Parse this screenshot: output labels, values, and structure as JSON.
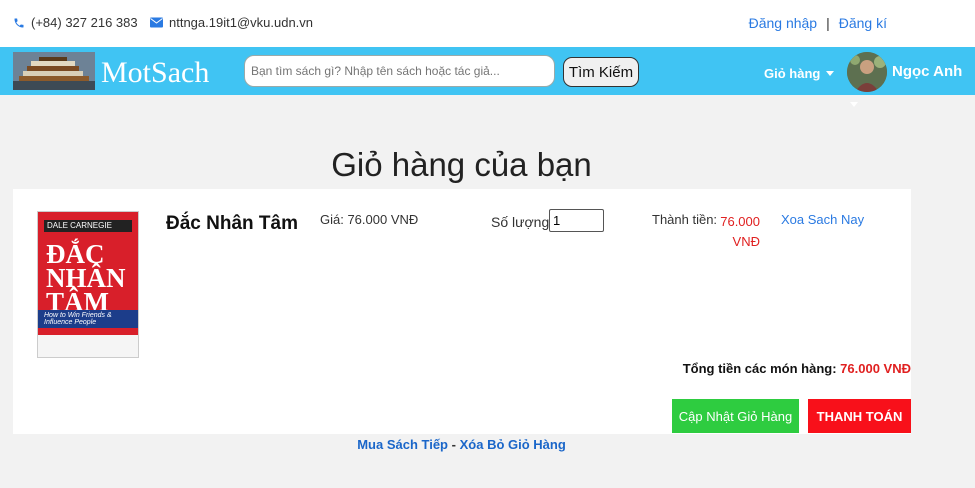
{
  "topbar": {
    "phone": "(+84) 327 216 383",
    "email": "nttnga.19it1@vku.udn.vn",
    "login": "Đăng nhập",
    "separator": "|",
    "register": "Đăng kí"
  },
  "navbar": {
    "logo_text": "MotSach",
    "search_placeholder": "Bạn tìm sách gì? Nhập tên sách hoặc tác giả...",
    "search_button": "Tìm Kiếm",
    "cart_menu": "Giỏ hàng",
    "user_name": "Ngọc Anh"
  },
  "page": {
    "title": "Giỏ hàng của bạn"
  },
  "cart": {
    "items": [
      {
        "title": "Đắc Nhân Tâm",
        "price_label": "Giá: 76.000 VNĐ",
        "qty_label": "Số lượng:",
        "qty_value": "1",
        "subtotal_label": "Thành tiền:",
        "subtotal_value": "76.000 VNĐ",
        "remove": "Xoa Sach Nay",
        "cover": {
          "author": "DALE CARNEGIE",
          "title": "ĐẮC NHÂN TÂM",
          "subtitle": "How to Win Friends & Influence People"
        }
      }
    ],
    "total_label": "Tổng tiền các món hàng:",
    "total_value": "76.000 VNĐ",
    "update_button": "Cập Nhật Giỏ Hàng",
    "pay_button": "THANH TOÁN"
  },
  "footer_links": {
    "continue": "Mua Sách Tiếp",
    "dash": "-",
    "clear": "Xóa Bỏ Giỏ Hàng"
  },
  "colors": {
    "navbar": "#40c4f3",
    "link": "#2a7ae2",
    "price_red": "#e02020",
    "update_green": "#2ecc40",
    "pay_red": "#f8101a"
  }
}
